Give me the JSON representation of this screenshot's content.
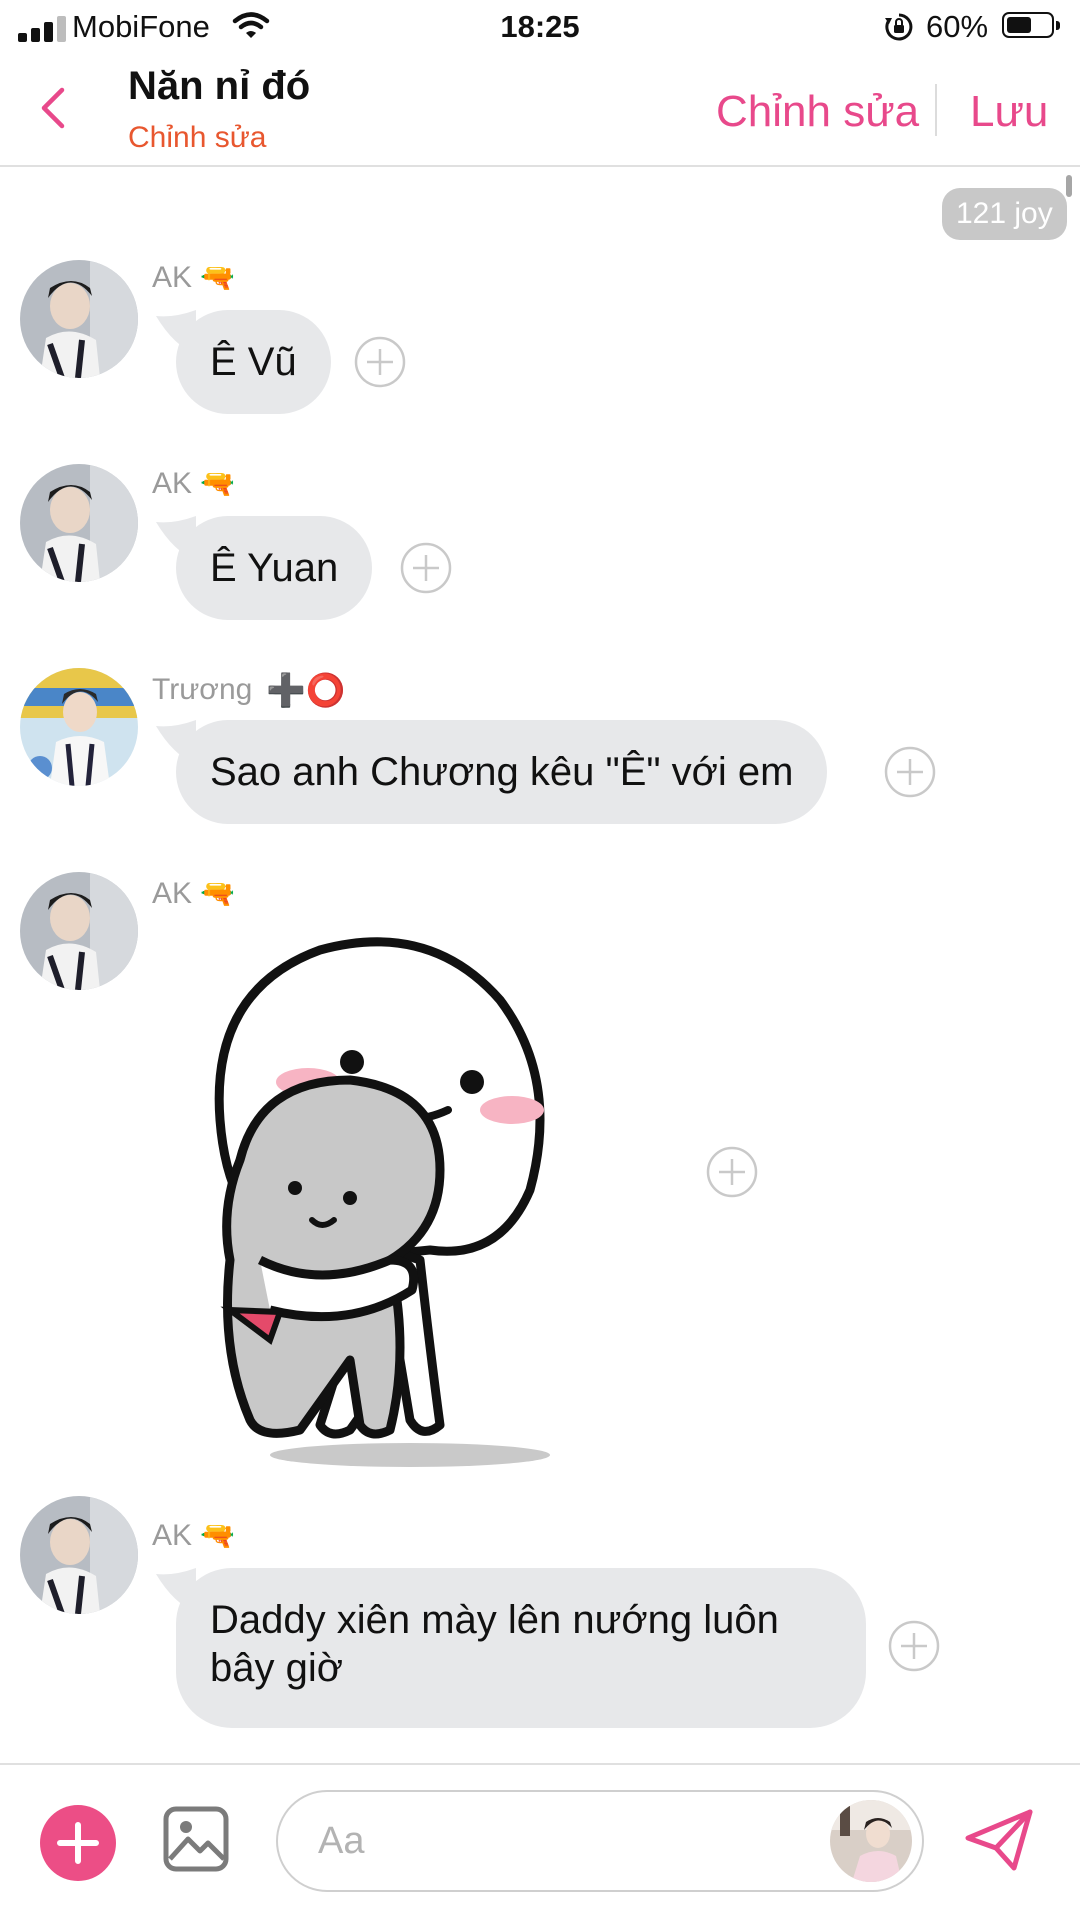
{
  "status_bar": {
    "carrier": "MobiFone",
    "time": "18:25",
    "battery_percent": "60%",
    "battery_level": 0.6
  },
  "header": {
    "title": "Năn nỉ đó",
    "subtitle": "Chỉnh sửa",
    "edit_label": "Chỉnh sửa",
    "save_label": "Lưu"
  },
  "chat": {
    "joy_badge": "121 joy",
    "messages": [
      {
        "sender": "AK",
        "badge": "🔫",
        "text": "Ê Vũ"
      },
      {
        "sender": "AK",
        "badge": "🔫",
        "text": "Ê Yuan"
      },
      {
        "sender": "Trương",
        "badge": "➕⭕",
        "text": "Sao anh Chương kêu \"Ê\" với em"
      },
      {
        "sender": "AK",
        "badge": "🔫",
        "sticker": "hug-sticker"
      },
      {
        "sender": "AK",
        "badge": "🔫",
        "text": "Daddy xiên mày lên nướng luôn bây giờ"
      }
    ]
  },
  "composer": {
    "placeholder": "Aa"
  },
  "colors": {
    "accent": "#e8498b",
    "subtitle": "#e8572f",
    "bubble": "#e7e8ea",
    "add_button": "#ec4e86"
  },
  "icons": {
    "back": "chevron-left-icon",
    "add": "plus-icon",
    "image": "image-icon",
    "send": "send-icon",
    "react": "add-reaction-icon",
    "wifi": "wifi-icon",
    "lock": "rotation-lock-icon"
  }
}
